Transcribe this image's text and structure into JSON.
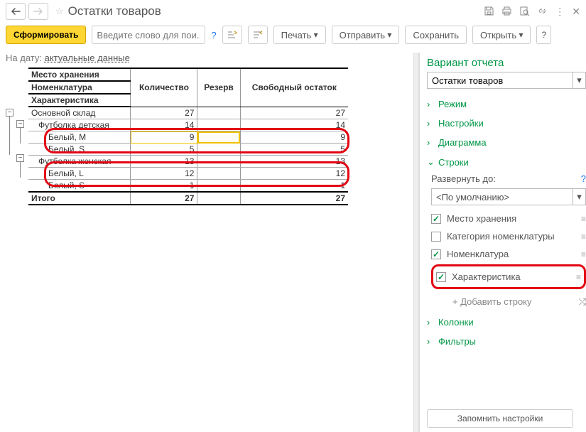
{
  "title": "Остатки товаров",
  "toolbar": {
    "generate": "Сформировать",
    "search_placeholder": "Введите слово для пои...",
    "print": "Печать",
    "send": "Отправить",
    "save": "Сохранить",
    "open": "Открыть"
  },
  "date": {
    "label": "На дату:",
    "value": "актуальные данные"
  },
  "grid": {
    "col1a": "Место хранения",
    "col1b": "Номенклатура",
    "col1c": "Характеристика",
    "col2": "Количество",
    "col3": "Резерв",
    "col4": "Свободный остаток",
    "rows": [
      {
        "name": "Основной склад",
        "qty": "27",
        "free": "27"
      },
      {
        "name": "Футболка детская",
        "qty": "14",
        "free": "14"
      },
      {
        "name": "Белый, M",
        "qty": "9",
        "free": "9"
      },
      {
        "name": "Белый, S",
        "qty": "5",
        "free": "5"
      },
      {
        "name": "Футболка женская",
        "qty": "13",
        "free": "13"
      },
      {
        "name": "Белый, L",
        "qty": "12",
        "free": "12"
      },
      {
        "name": "Белый, S",
        "qty": "1",
        "free": "1"
      }
    ],
    "total": {
      "label": "Итого",
      "qty": "27",
      "free": "27"
    }
  },
  "panel": {
    "title": "Вариант отчета",
    "variant": "Остатки товаров",
    "mode": "Режим",
    "settings": "Настройки",
    "chart": "Диаграмма",
    "rows": "Строки",
    "expand_label": "Развернуть до:",
    "expand_value": "<По умолчанию>",
    "chk1": "Место хранения",
    "chk2": "Категория номенклатуры",
    "chk3": "Номенклатура",
    "chk4": "Характеристика",
    "add": "+ Добавить строку",
    "columns": "Колонки",
    "filters": "Фильтры",
    "save": "Запомнить настройки"
  }
}
